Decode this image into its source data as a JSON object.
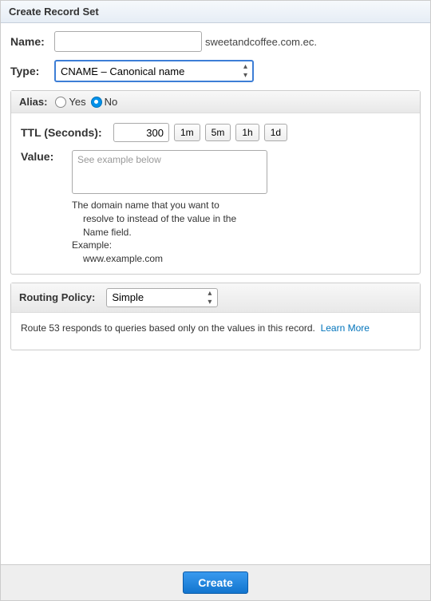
{
  "header": {
    "title": "Create Record Set"
  },
  "name": {
    "label": "Name:",
    "value": "",
    "suffix": "sweetandcoffee.com.ec."
  },
  "type": {
    "label": "Type:",
    "selected": "CNAME – Canonical name"
  },
  "alias": {
    "label": "Alias:",
    "options": {
      "yes": "Yes",
      "no": "No"
    },
    "selected": "no"
  },
  "ttl": {
    "label": "TTL (Seconds):",
    "value": "300",
    "presets": [
      "1m",
      "5m",
      "1h",
      "1d"
    ]
  },
  "value_field": {
    "label": "Value:",
    "placeholder": "See example below",
    "help_line1": "The domain name that you want to",
    "help_line2": "resolve to instead of the value in the",
    "help_line3": "Name field.",
    "help_example_label": "Example:",
    "help_example_value": "www.example.com"
  },
  "routing": {
    "label": "Routing Policy:",
    "selected": "Simple",
    "description": "Route 53 responds to queries based only on the values in this record.",
    "learn_more": "Learn More"
  },
  "footer": {
    "create": "Create"
  }
}
